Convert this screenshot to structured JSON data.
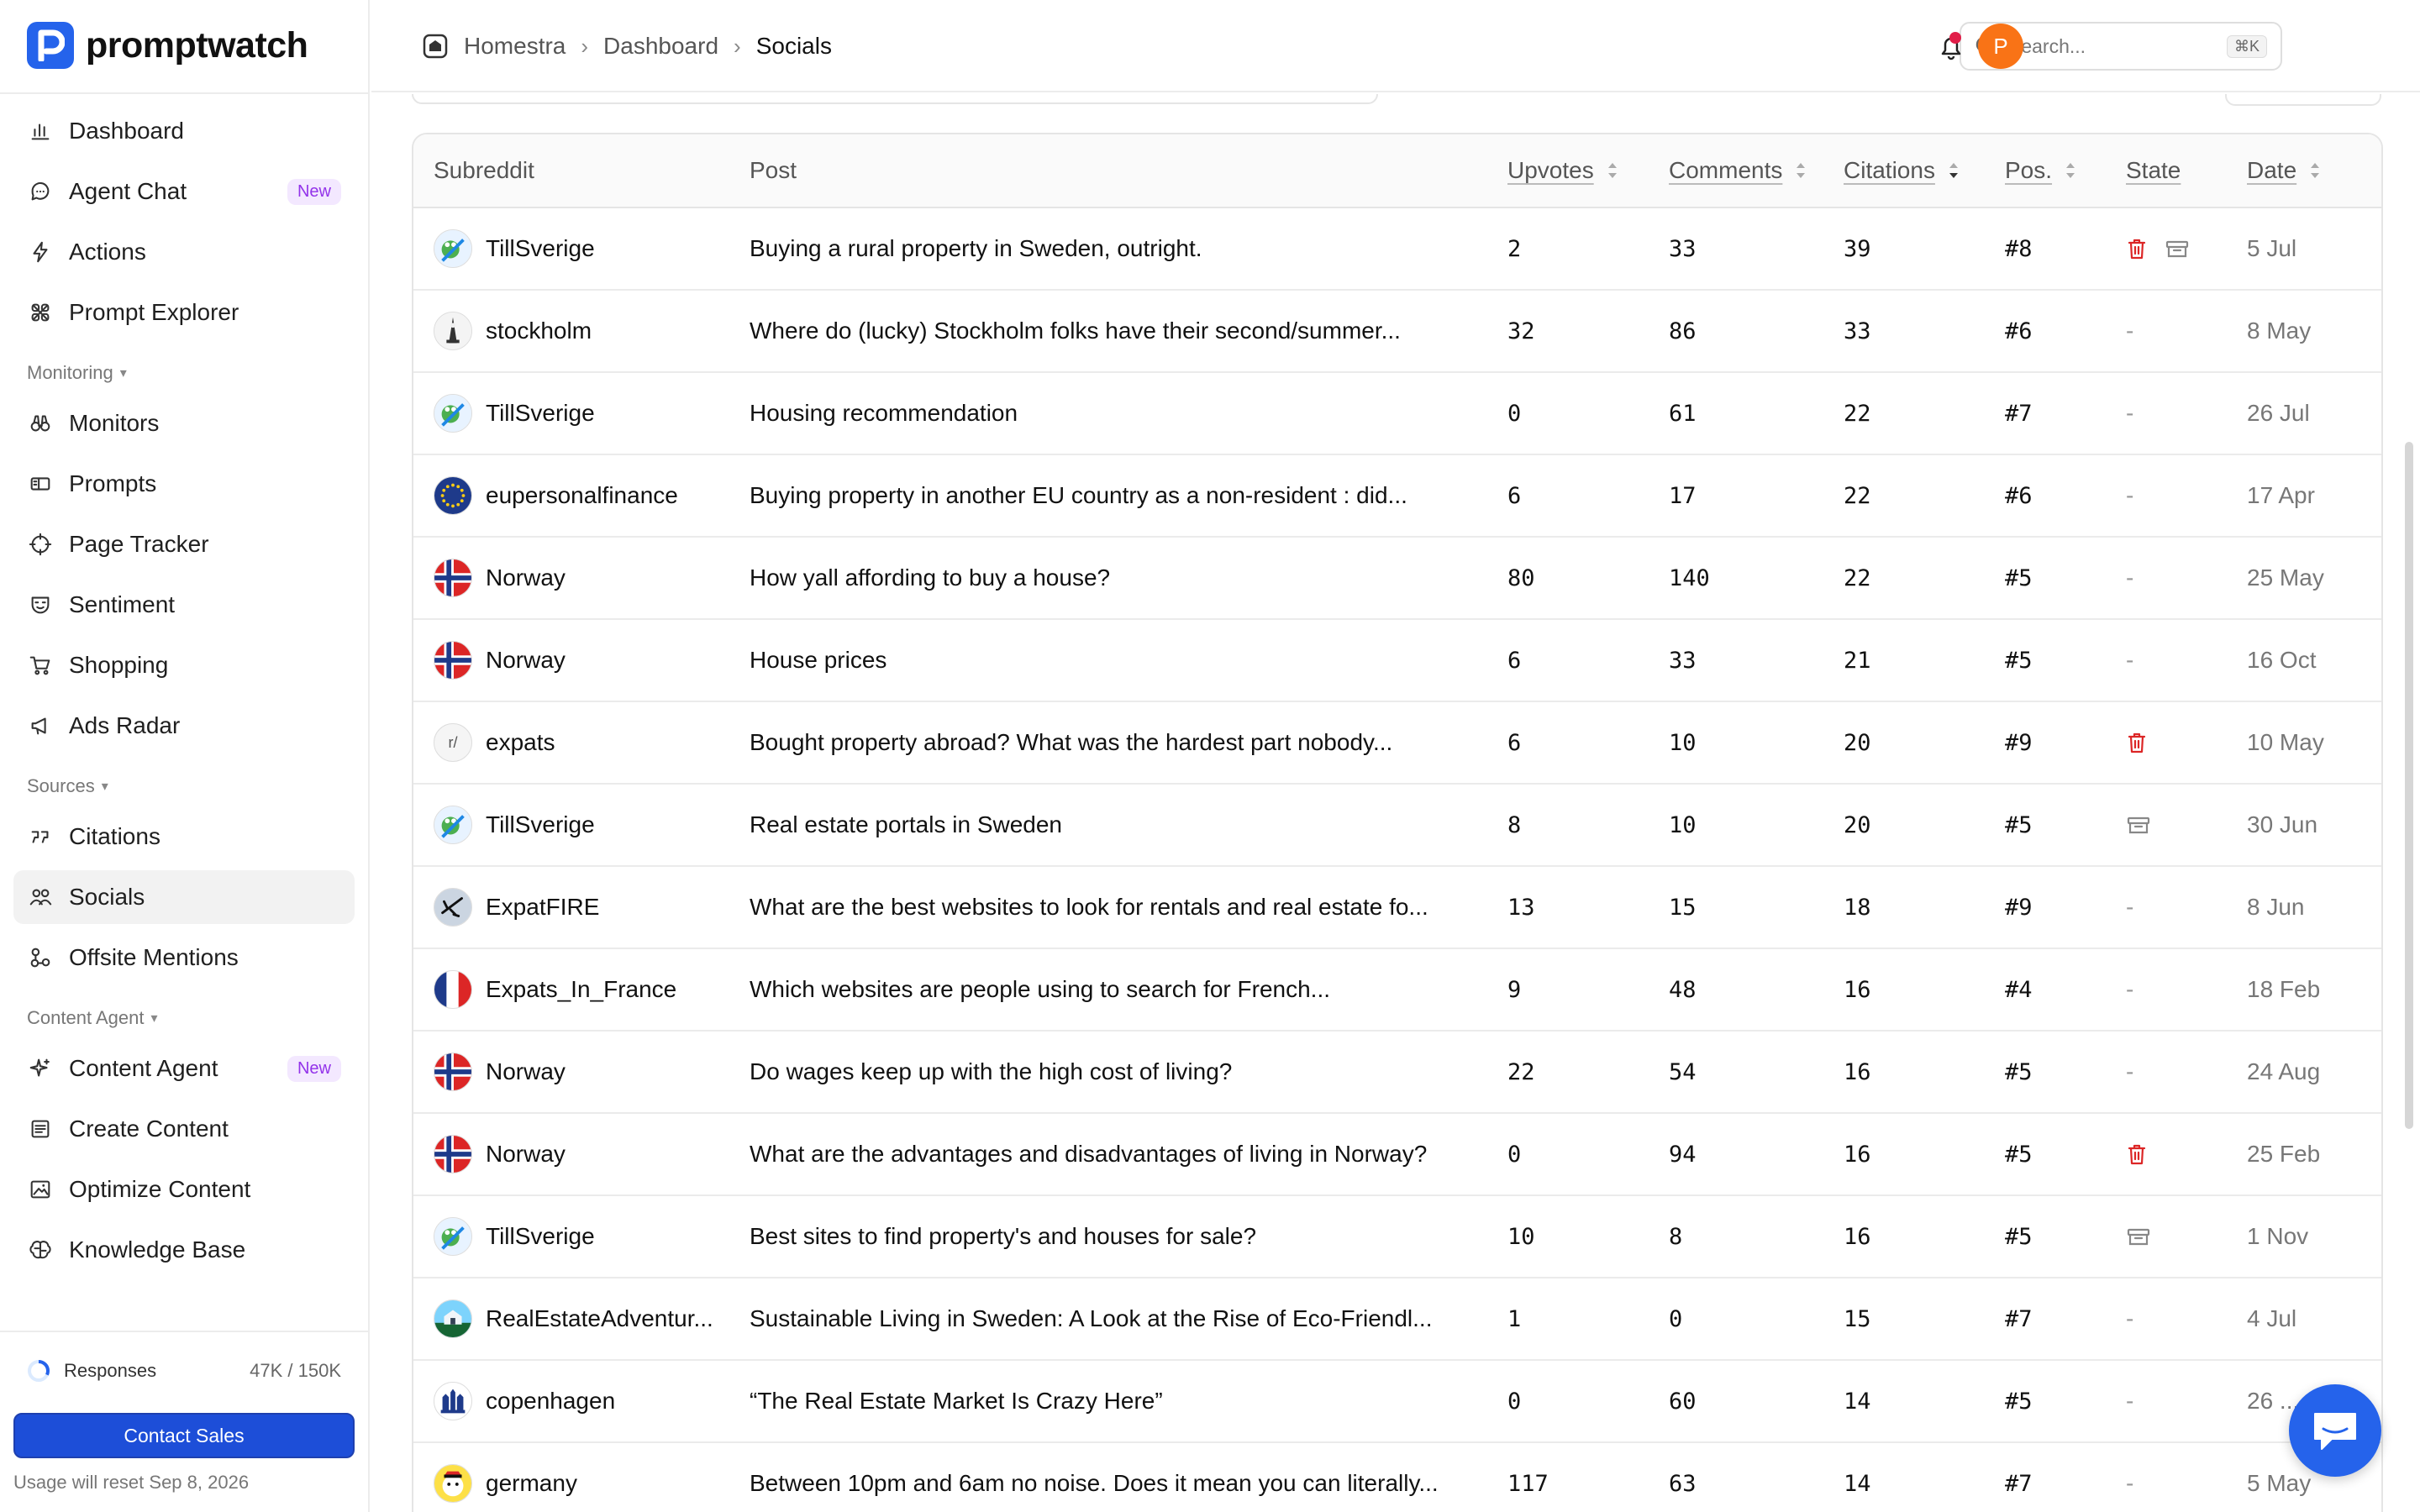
{
  "brand": {
    "name": "promptwatch",
    "color": "#2563eb"
  },
  "breadcrumb": {
    "workspace": "Homestra",
    "parent": "Dashboard",
    "current": "Socials"
  },
  "search": {
    "placeholder": "Search...",
    "shortcut": "⌘K"
  },
  "user": {
    "initial": "P"
  },
  "sidebar": {
    "items_top": [
      {
        "label": "Dashboard",
        "icon": "bar-chart-icon"
      },
      {
        "label": "Agent Chat",
        "icon": "chat-bubble-icon",
        "badge": "New"
      },
      {
        "label": "Actions",
        "icon": "lightning-icon"
      },
      {
        "label": "Prompt Explorer",
        "icon": "atom-icon"
      }
    ],
    "monitoring_label": "Monitoring",
    "monitoring_items": [
      {
        "label": "Monitors",
        "icon": "binoculars-icon"
      },
      {
        "label": "Prompts",
        "icon": "prompt-icon"
      },
      {
        "label": "Page Tracker",
        "icon": "crosshair-icon"
      },
      {
        "label": "Sentiment",
        "icon": "mask-icon"
      },
      {
        "label": "Shopping",
        "icon": "cart-icon"
      },
      {
        "label": "Ads Radar",
        "icon": "megaphone-icon"
      }
    ],
    "sources_label": "Sources",
    "sources_items": [
      {
        "label": "Citations",
        "icon": "quote-icon"
      },
      {
        "label": "Socials",
        "icon": "people-icon",
        "active": true
      },
      {
        "label": "Offsite Mentions",
        "icon": "nodes-icon"
      }
    ],
    "content_label": "Content Agent",
    "content_items": [
      {
        "label": "Content Agent",
        "icon": "sparkle-icon",
        "badge": "New"
      },
      {
        "label": "Create Content",
        "icon": "document-icon"
      },
      {
        "label": "Optimize Content",
        "icon": "image-frame-icon"
      },
      {
        "label": "Knowledge Base",
        "icon": "brain-icon"
      }
    ],
    "usage": {
      "label": "Responses",
      "value": "47K / 150K"
    },
    "contact_label": "Contact Sales",
    "reset_note": "Usage will reset Sep 8, 2026"
  },
  "table": {
    "headers": {
      "subreddit": "Subreddit",
      "post": "Post",
      "upvotes": "Upvotes",
      "comments": "Comments",
      "citations": "Citations",
      "pos": "Pos.",
      "state": "State",
      "date": "Date"
    },
    "rows": [
      {
        "subreddit": "TillSverige",
        "avatar": "frog",
        "post": "Buying a rural property in Sweden, outright.",
        "upvotes": "2",
        "comments": "33",
        "citations": "39",
        "pos": "#8",
        "state": [
          "trash",
          "archive"
        ],
        "date": "5 Jul"
      },
      {
        "subreddit": "stockholm",
        "avatar": "tower",
        "post": "Where do (lucky) Stockholm folks have their second/summer...",
        "upvotes": "32",
        "comments": "86",
        "citations": "33",
        "pos": "#6",
        "state": "-",
        "date": "8 May"
      },
      {
        "subreddit": "TillSverige",
        "avatar": "frog",
        "post": "Housing recommendation",
        "upvotes": "0",
        "comments": "61",
        "citations": "22",
        "pos": "#7",
        "state": "-",
        "date": "26 Jul"
      },
      {
        "subreddit": "eupersonalfinance",
        "avatar": "eu",
        "post": "Buying property in another EU country as a non-resident : did...",
        "upvotes": "6",
        "comments": "17",
        "citations": "22",
        "pos": "#6",
        "state": "-",
        "date": "17 Apr"
      },
      {
        "subreddit": "Norway",
        "avatar": "norway",
        "post": "How yall affording to buy a house?",
        "upvotes": "80",
        "comments": "140",
        "citations": "22",
        "pos": "#5",
        "state": "-",
        "date": "25 May"
      },
      {
        "subreddit": "Norway",
        "avatar": "norway",
        "post": "House prices",
        "upvotes": "6",
        "comments": "33",
        "citations": "21",
        "pos": "#5",
        "state": "-",
        "date": "16 Oct"
      },
      {
        "subreddit": "expats",
        "avatar": "r",
        "post": "Bought property abroad? What was the hardest part nobody...",
        "upvotes": "6",
        "comments": "10",
        "citations": "20",
        "pos": "#9",
        "state": [
          "trash"
        ],
        "date": "10 May"
      },
      {
        "subreddit": "TillSverige",
        "avatar": "frog",
        "post": "Real estate portals in Sweden",
        "upvotes": "8",
        "comments": "10",
        "citations": "20",
        "pos": "#5",
        "state": [
          "archive"
        ],
        "date": "30 Jun"
      },
      {
        "subreddit": "ExpatFIRE",
        "avatar": "plane",
        "post": "What are the best websites to look for rentals and real estate fo...",
        "upvotes": "13",
        "comments": "15",
        "citations": "18",
        "pos": "#9",
        "state": "-",
        "date": "8 Jun"
      },
      {
        "subreddit": "Expats_In_France",
        "avatar": "france",
        "post": "Which websites are people using to search for French...",
        "upvotes": "9",
        "comments": "48",
        "citations": "16",
        "pos": "#4",
        "state": "-",
        "date": "18 Feb"
      },
      {
        "subreddit": "Norway",
        "avatar": "norway",
        "post": "Do wages keep up with the high cost of living?",
        "upvotes": "22",
        "comments": "54",
        "citations": "16",
        "pos": "#5",
        "state": "-",
        "date": "24 Aug"
      },
      {
        "subreddit": "Norway",
        "avatar": "norway",
        "post": "What are the advantages and disadvantages of living in Norway?",
        "upvotes": "0",
        "comments": "94",
        "citations": "16",
        "pos": "#5",
        "state": [
          "trash"
        ],
        "date": "25 Feb"
      },
      {
        "subreddit": "TillSverige",
        "avatar": "frog",
        "post": "Best sites to find property's and houses for sale?",
        "upvotes": "10",
        "comments": "8",
        "citations": "16",
        "pos": "#5",
        "state": [
          "archive"
        ],
        "date": "1 Nov"
      },
      {
        "subreddit": "RealEstateAdventur...",
        "avatar": "house",
        "post": "Sustainable Living in Sweden: A Look at the Rise of Eco-Friendl...",
        "upvotes": "1",
        "comments": "0",
        "citations": "15",
        "pos": "#7",
        "state": "-",
        "date": "4 Jul"
      },
      {
        "subreddit": "copenhagen",
        "avatar": "castle",
        "post": "“The Real Estate Market Is Crazy Here”",
        "upvotes": "0",
        "comments": "60",
        "citations": "14",
        "pos": "#5",
        "state": "-",
        "date": "26 ..."
      },
      {
        "subreddit": "germany",
        "avatar": "germany",
        "post": "Between 10pm and 6am no noise. Does it mean you can literally...",
        "upvotes": "117",
        "comments": "63",
        "citations": "14",
        "pos": "#7",
        "state": "-",
        "date": "5 May"
      }
    ]
  },
  "colors": {
    "accent": "#1d4ed8",
    "badge": "#9333ea",
    "danger": "#dc2626",
    "avatar": "#f97316"
  }
}
